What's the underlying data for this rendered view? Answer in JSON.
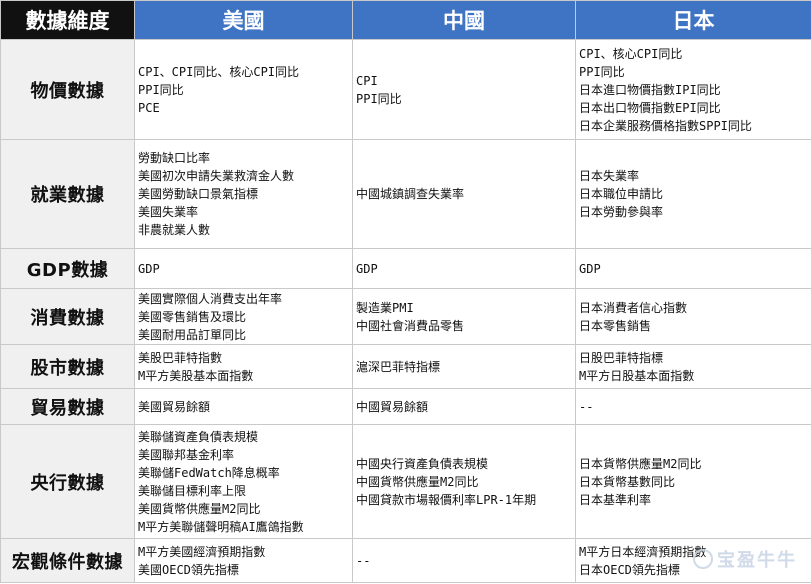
{
  "headers": [
    "數據維度",
    "美國",
    "中國",
    "日本"
  ],
  "rows": [
    {
      "category": "物價數據",
      "us": [
        "CPI、CPI同比、核心CPI同比",
        "PPI同比",
        "PCE"
      ],
      "cn": [
        "CPI",
        "PPI同比"
      ],
      "jp": [
        "CPI、核心CPI同比",
        "PPI同比",
        "日本進口物價指數IPI同比",
        "日本出口物價指數EPI同比",
        "日本企業服務價格指數SPPI同比"
      ]
    },
    {
      "category": "就業數據",
      "us": [
        "勞動缺口比率",
        "美國初次申請失業救濟金人數",
        "美國勞動缺口景氣指標",
        "美國失業率",
        "非農就業人數"
      ],
      "cn": [
        "中國城鎮調查失業率"
      ],
      "jp": [
        "日本失業率",
        "日本職位申請比",
        "日本勞動參與率"
      ]
    },
    {
      "category": "GDP數據",
      "us": [
        "GDP"
      ],
      "cn": [
        "GDP"
      ],
      "jp": [
        "GDP"
      ]
    },
    {
      "category": "消費數據",
      "us": [
        "美國實際個人消費支出年率",
        "美國零售銷售及環比",
        "美國耐用品訂單同比"
      ],
      "cn": [
        "製造業PMI",
        "中國社會消費品零售"
      ],
      "jp": [
        "日本消費者信心指數",
        "日本零售銷售"
      ]
    },
    {
      "category": "股市數據",
      "us": [
        "美股巴菲特指數",
        "M平方美股基本面指數"
      ],
      "cn": [
        "滬深巴菲特指標"
      ],
      "jp": [
        "日股巴菲特指標",
        "M平方日股基本面指數"
      ]
    },
    {
      "category": "貿易數據",
      "us": [
        "美國貿易餘額"
      ],
      "cn": [
        "中國貿易餘額"
      ],
      "jp": [
        "--"
      ]
    },
    {
      "category": "央行數據",
      "us": [
        "美聯儲資產負債表規模",
        "美國聯邦基金利率",
        "美聯儲FedWatch降息概率",
        "美聯儲目標利率上限",
        "美國貨幣供應量M2同比",
        "M平方美聯儲聲明稿AI鷹鴿指數"
      ],
      "cn": [
        "中國央行資產負債表規模",
        "中國貨幣供應量M2同比",
        "中國貸款市場報價利率LPR-1年期"
      ],
      "jp": [
        "日本貨幣供應量M2同比",
        "日本貨幣基數同比",
        "日本基準利率"
      ]
    },
    {
      "category": "宏觀條件數據",
      "us": [
        "M平方美國經濟預期指數",
        "美國OECD領先指標"
      ],
      "cn": [
        "--"
      ],
      "jp": [
        "M平方日本經濟預期指數",
        "日本OECD領先指標"
      ]
    }
  ],
  "watermark": "宝盈牛牛"
}
